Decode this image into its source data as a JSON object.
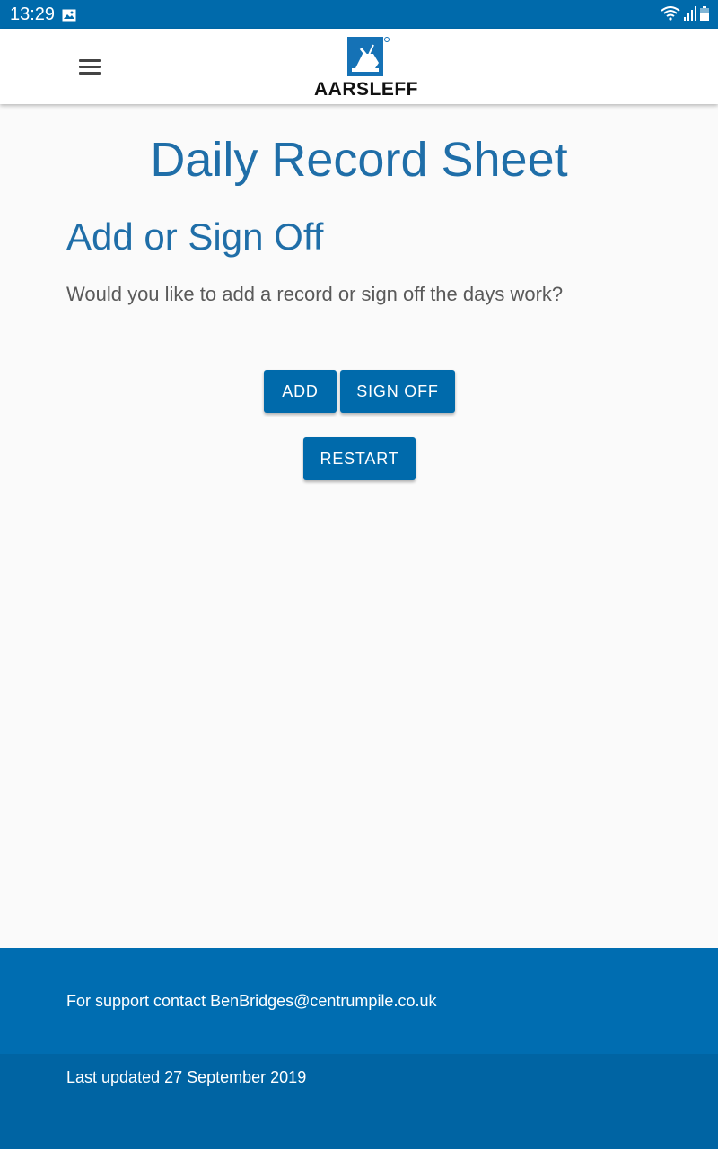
{
  "status_bar": {
    "time": "13:29",
    "icons": [
      "image-icon",
      "wifi-icon",
      "signal-icon",
      "battery-icon"
    ]
  },
  "app_bar": {
    "menu_icon": "hamburger-menu-icon",
    "logo_text": "AARSLEFF"
  },
  "main": {
    "page_title": "Daily Record Sheet",
    "section_title": "Add or Sign Off",
    "question": "Would you like to add a record or sign off the days work?",
    "buttons": {
      "add": "ADD",
      "sign_off": "SIGN OFF",
      "restart": "RESTART"
    }
  },
  "footer": {
    "support_text": "For support contact BenBridges@centrumpile.co.uk",
    "last_updated": "Last updated 27 September 2019"
  },
  "colors": {
    "primary": "#006aab",
    "title": "#1f6ea8",
    "background": "#fafafa"
  }
}
